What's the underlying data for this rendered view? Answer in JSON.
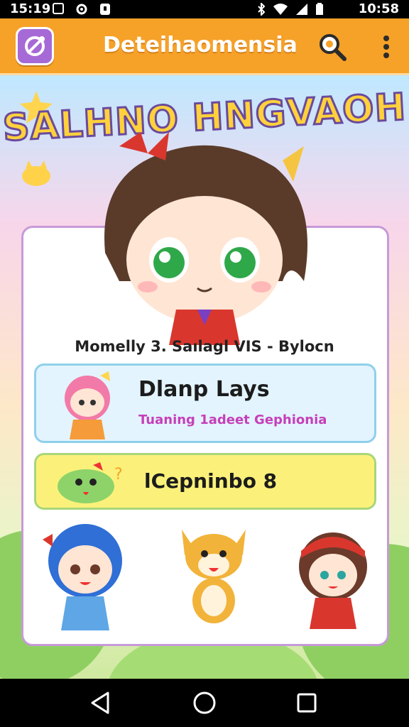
{
  "status_bar": {
    "time_left": "15:19",
    "time_right": "10:58",
    "icons": [
      "image-icon",
      "settings-icon",
      "notification-icon",
      "bluetooth-icon",
      "wifi-icon",
      "signal-icon",
      "battery-icon"
    ]
  },
  "app_bar": {
    "title": "Deteihaomensia",
    "icons": [
      "app-logo-icon",
      "search-icon",
      "more-vert-icon"
    ],
    "accent_color": "#f6a127"
  },
  "main": {
    "headline": "SALHNO HNGVAOH",
    "subtitle": "Momelly 3. Saılagl VIS - Bylocn",
    "items": [
      {
        "title": "Dlanp Lays",
        "subtitle": "Tuaning 1adeet Gephionia",
        "icon": "pink-hair-girl-avatar"
      },
      {
        "title": "lCepninbo 8",
        "icon": "green-dino-avatar"
      }
    ],
    "characters": [
      "blue-hair-girl",
      "orange-fox",
      "red-hat-girl"
    ]
  },
  "nav_bar": {
    "icons": [
      "back-icon",
      "home-icon",
      "recents-icon"
    ]
  }
}
